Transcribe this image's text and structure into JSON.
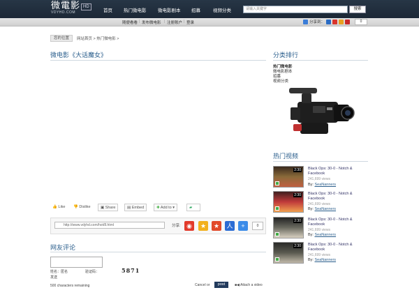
{
  "header": {
    "logo": "微電影",
    "logo_sub": "VDYHD.COM",
    "logo_hd": "HD",
    "nav": [
      "首页",
      "热门微电影",
      "微电影剧本",
      "招募",
      "视频分类"
    ],
    "search_placeholder": "请输入关键字",
    "search_button": "搜索"
  },
  "subbar": {
    "links": [
      "随便看看",
      "发布微电影",
      "注册账户",
      "登录"
    ],
    "share_label": "分享到：",
    "share_count": "0"
  },
  "breadcrumb": {
    "label": "您的位置",
    "path": "网站首页 > 热门微电影 >"
  },
  "main": {
    "title": "微电影《大话魔女》",
    "toolbar": {
      "like": "Like",
      "dislike": "Dislike",
      "share": "Share",
      "embed": "Embed",
      "add_to": "Add to"
    },
    "url": "http://www.vdyhd.com/hot/8.html",
    "share_label": "分享:",
    "share_count": "0"
  },
  "comments": {
    "title": "网友评论",
    "name_label": "姓名：匿名",
    "captcha_label": "验证码：",
    "captcha_value": "5871",
    "send": "发送",
    "remaining": "500 characters remaining",
    "cancel": "Cancel or",
    "post": "post",
    "attach": "Attach a video"
  },
  "sidebar": {
    "category_title": "分类排行",
    "categories": [
      "热门微电影",
      "微电影剧本",
      "招募",
      "视频分类"
    ],
    "hot_title": "热门视频",
    "videos": [
      {
        "time": "2:30",
        "title": "Black Ops: 30-0 - Notch & Facebook",
        "views": "241,699 views",
        "by": "By:",
        "author": "SeaNanners"
      },
      {
        "time": "2:30",
        "title": "Black Ops: 30-0 - Notch & Facebook",
        "views": "241,699 views",
        "by": "By:",
        "author": "SeaNanners"
      },
      {
        "time": "2:30",
        "title": "Black Ops: 30-0 - Notch & Facebook",
        "views": "241,699 views",
        "by": "By:",
        "author": "SeaNanners"
      },
      {
        "time": "2:30",
        "title": "Black Ops: 30-0 - Notch & Facebook",
        "views": "241,699 views",
        "by": "By:",
        "author": "SeaNanners"
      }
    ]
  },
  "colors": {
    "header_bg": "#1c2836",
    "link_blue": "#2a5e8c",
    "post_button": "#223a5c"
  }
}
